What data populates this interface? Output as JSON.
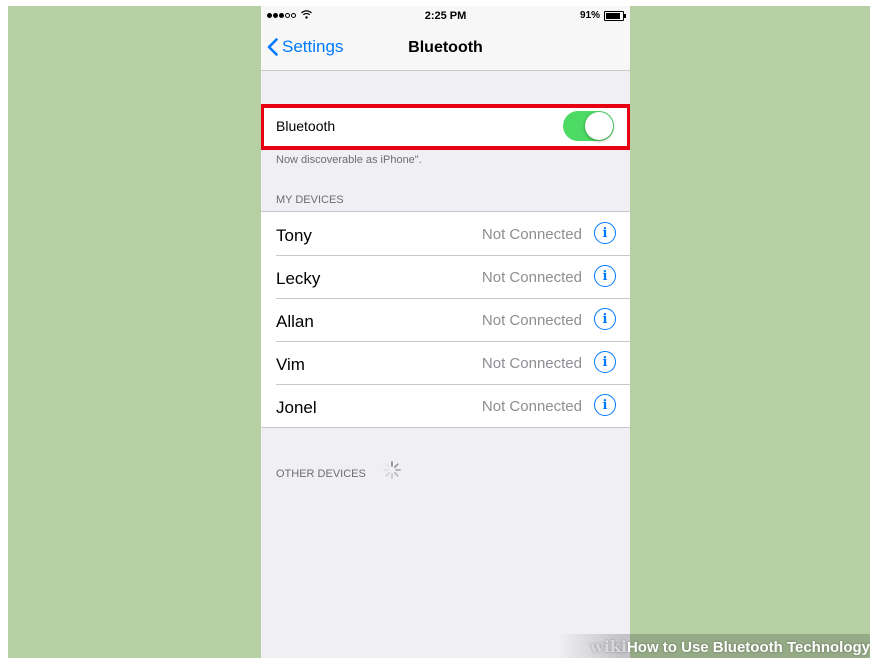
{
  "status_bar": {
    "time": "2:25 PM",
    "battery_percent": "91%",
    "signal_bars_filled": 3,
    "signal_bars_total": 5
  },
  "nav": {
    "back_label": "Settings",
    "title": "Bluetooth"
  },
  "bluetooth_toggle": {
    "label": "Bluetooth",
    "on": true
  },
  "discoverable_text": "Now discoverable as iPhone\".",
  "my_devices": {
    "header": "MY DEVICES",
    "items": [
      {
        "name": "Tony",
        "status": "Not Connected"
      },
      {
        "name": "Lecky",
        "status": "Not Connected"
      },
      {
        "name": "Allan",
        "status": "Not Connected"
      },
      {
        "name": "Vim",
        "status": "Not Connected"
      },
      {
        "name": "Jonel",
        "status": "Not Connected"
      }
    ]
  },
  "other_devices": {
    "header": "OTHER DEVICES"
  },
  "watermark": {
    "brand": "wiki",
    "text": "How to Use Bluetooth Technology"
  },
  "colors": {
    "background": "#b6cfa3",
    "accent": "#007aff",
    "toggle_on": "#4cd964",
    "highlight": "#e60012"
  }
}
